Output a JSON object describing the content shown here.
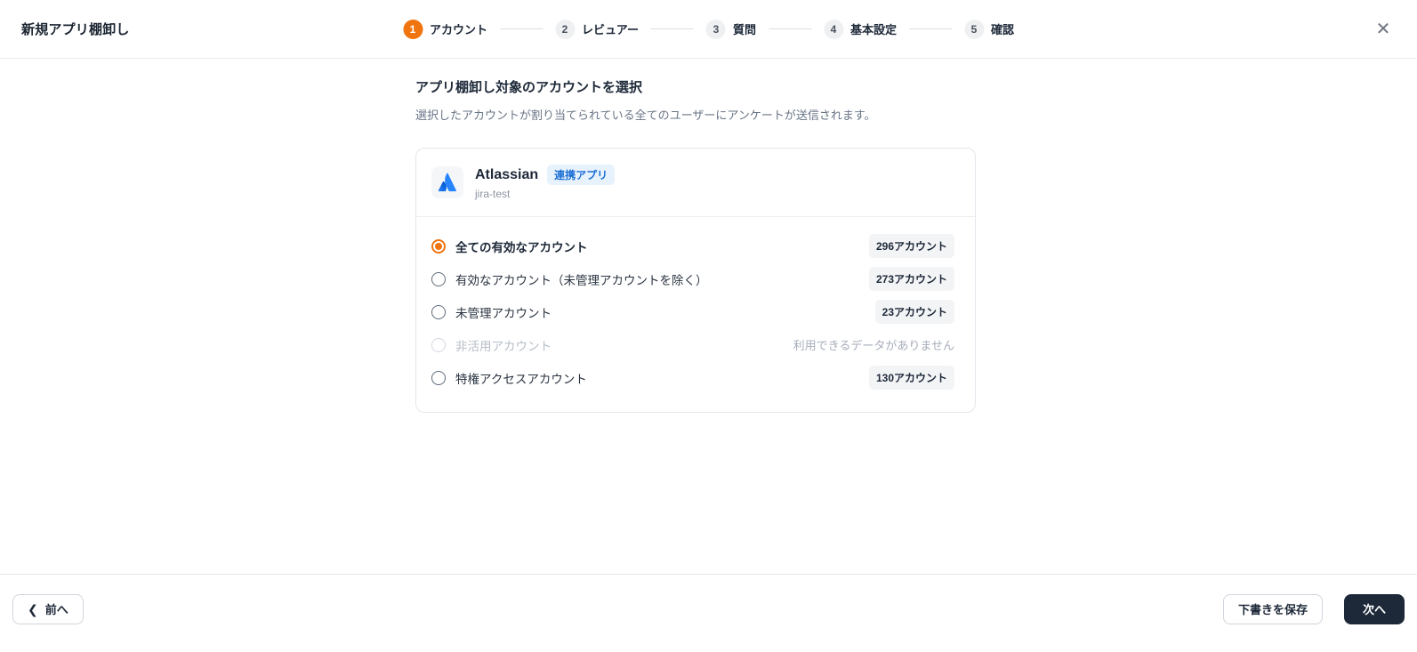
{
  "header": {
    "title": "新規アプリ棚卸し",
    "steps": [
      {
        "number": "1",
        "label": "アカウント"
      },
      {
        "number": "2",
        "label": "レビュアー"
      },
      {
        "number": "3",
        "label": "質問"
      },
      {
        "number": "4",
        "label": "基本設定"
      },
      {
        "number": "5",
        "label": "確認"
      }
    ],
    "close_glyph": "✕"
  },
  "main": {
    "heading": "アプリ棚卸し対象のアカウントを選択",
    "subheading": "選択したアカウントが割り当てられている全てのユーザーにアンケートが送信されます。",
    "app_card": {
      "name": "Atlassian",
      "badge": "連携アプリ",
      "subtitle": "jira-test",
      "options": [
        {
          "label": "全ての有効なアカウント",
          "count": "296アカウント",
          "state": "selected"
        },
        {
          "label": "有効なアカウント（未管理アカウントを除く）",
          "count": "273アカウント",
          "state": "default"
        },
        {
          "label": "未管理アカウント",
          "count": "23アカウント",
          "state": "default"
        },
        {
          "label": "非活用アカウント",
          "note": "利用できるデータがありません",
          "state": "disabled"
        },
        {
          "label": "特権アクセスアカウント",
          "count": "130アカウント",
          "state": "default"
        }
      ]
    }
  },
  "footer": {
    "back_label": "前へ",
    "back_chevron": "❮",
    "save_draft_label": "下書きを保存",
    "next_label": "次へ"
  },
  "colors": {
    "accent_orange": "#f0740f",
    "badge_blue_bg": "#e8f2fd",
    "badge_blue_text": "#1b6fd4",
    "dark_button": "#1d2838",
    "atlassian_blue": "#2684ff"
  }
}
